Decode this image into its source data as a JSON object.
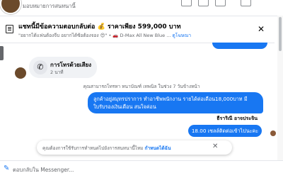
{
  "header": {
    "contact_label": "มอบหมายการสนทนานี้"
  },
  "pinned": {
    "title": "แชทนี้มีข้อความตอบกลับต่อ 💰 ราคาเพียง 599,000 บาท",
    "subtitle": "\"อยากได้แฟนต้องจีบ อยากได้ซ้อต้องจอง 😍\" • 🚗 D-Max All New Blue ...",
    "link": "ดูโฆษณา"
  },
  "call": {
    "title": "การโทรด้วยเสียง",
    "duration": "2 นาที"
  },
  "system_message": "คุณสามารถโทรหา หนาบัณฑ์ เทพนิล ในช่วง 7 วันข้างหน้า",
  "messages": [
    {
      "text": "ลูกค้าอยู่สมุทรปราการ ทำอาชีพพนักงาน รายได้ต่อเดือน18,000บาท มีใบรับรองเงินเดือน สนใจค่อน"
    },
    {
      "sender": "ธีราริณี อาจประจิน",
      "text": "18.00 เซลล์ติดต่อเข้าไปนะคะ"
    }
  ],
  "notice": {
    "text": "คุณต้องการใช้รับการทำหนดไปยังการสนทนานี้ไหม",
    "link": "กำหนดได้ฉัน"
  },
  "composer": {
    "placeholder": "ตอบกลับใน Messenger..."
  },
  "colors": {
    "accent": "#1877f2",
    "bubble_out": "#1877f2"
  }
}
